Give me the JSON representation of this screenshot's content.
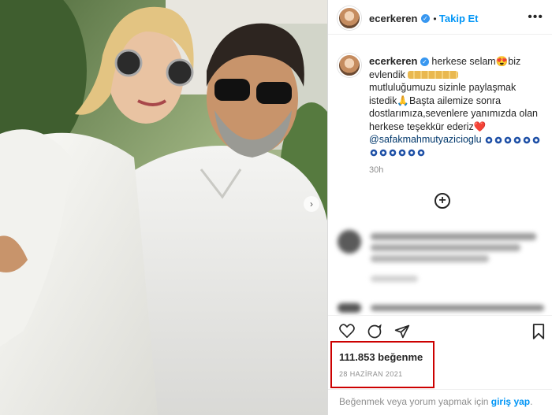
{
  "post": {
    "username": "ecerkeren",
    "follow_label": "Takip Et",
    "more_icon": "more-horizontal-icon"
  },
  "caption": {
    "username": "ecerkeren",
    "line1": "herkese selam😍biz",
    "line2": "evlendik",
    "line3": "mutluluğumuzu sizinle paylaşmak",
    "line4": "istedik🙏Başta ailemize sonra",
    "line5": "dostlarımıza,sevenlere yanımızda olan",
    "line6": "herkese teşekkür ederiz❤️",
    "mention": "@safakmahmutyazicioglu",
    "time": "30h"
  },
  "actions": {
    "like_icon": "heart-icon",
    "comment_icon": "comment-icon",
    "share_icon": "send-icon",
    "save_icon": "bookmark-icon"
  },
  "stats": {
    "likes": "111.853 beğenme",
    "date": "28 HAZİRAN 2021"
  },
  "footer": {
    "prompt": "Beğenmek veya yorum yapmak için",
    "login_link": "giriş yap",
    "trailing": "."
  },
  "colors": {
    "accent_blue": "#0095f6",
    "highlight_red": "#cc0000",
    "text_dark": "#262626",
    "text_muted": "#8e8e8e"
  }
}
